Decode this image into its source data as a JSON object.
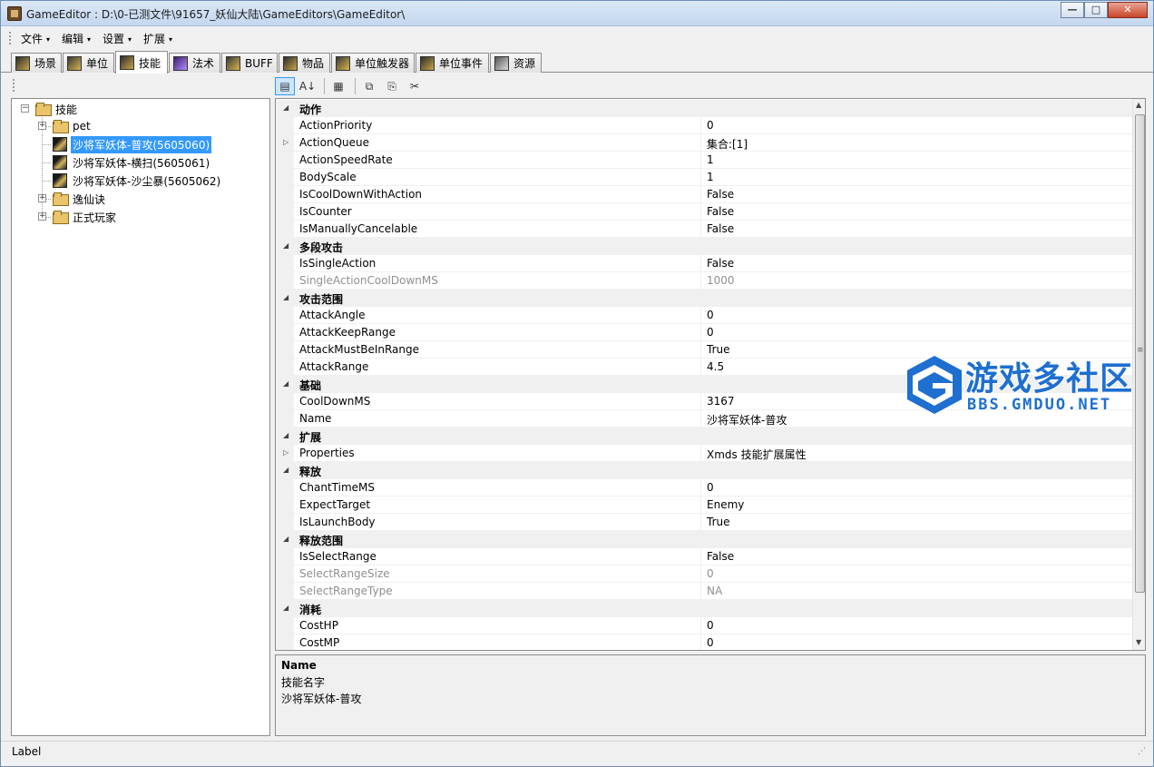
{
  "window": {
    "title": "GameEditor : D:\\0-已测文件\\91657_妖仙大陆\\GameEditors\\GameEditor\\",
    "controls": {
      "minimize": "—",
      "maximize": "□",
      "close": "✕"
    }
  },
  "menu": [
    {
      "label": "文件",
      "arrow": "▾"
    },
    {
      "label": "编辑",
      "arrow": "▾"
    },
    {
      "label": "设置",
      "arrow": "▾"
    },
    {
      "label": "扩展",
      "arrow": "▾"
    }
  ],
  "tabs": [
    {
      "label": "场景",
      "active": false
    },
    {
      "label": "单位",
      "active": false
    },
    {
      "label": "技能",
      "active": true
    },
    {
      "label": "法术",
      "active": false
    },
    {
      "label": "BUFF",
      "active": false
    },
    {
      "label": "物品",
      "active": false
    },
    {
      "label": "单位触发器",
      "active": false
    },
    {
      "label": "单位事件",
      "active": false
    },
    {
      "label": "资源",
      "active": false
    }
  ],
  "tree": {
    "root": "技能",
    "nodes": [
      {
        "label": "pet",
        "icon": "folder-icon",
        "expander": "+"
      },
      {
        "label": "沙将军妖体-普攻(5605060)",
        "icon": "skill-icon",
        "selected": true
      },
      {
        "label": "沙将军妖体-横扫(5605061)",
        "icon": "skill-icon"
      },
      {
        "label": "沙将军妖体-沙尘暴(5605062)",
        "icon": "skill-icon"
      },
      {
        "label": "逸仙诀",
        "icon": "folder-icon",
        "expander": "+"
      },
      {
        "label": "正式玩家",
        "icon": "folder-icon",
        "expander": "+"
      }
    ],
    "root_expander": "−"
  },
  "toolbar": {
    "categorized": "▤",
    "alphabetical": "A↓",
    "pages": "▦",
    "copy": "⧉",
    "paste": "⎘",
    "cut": "✂"
  },
  "grid": {
    "rows": [
      {
        "type": "cat",
        "name": "动作"
      },
      {
        "type": "prop",
        "name": "ActionPriority",
        "value": "0"
      },
      {
        "type": "prop",
        "name": "ActionQueue",
        "value": "集合:[1]",
        "expandable": true
      },
      {
        "type": "prop",
        "name": "ActionSpeedRate",
        "value": "1"
      },
      {
        "type": "prop",
        "name": "BodyScale",
        "value": "1"
      },
      {
        "type": "prop",
        "name": "IsCoolDownWithAction",
        "value": "False"
      },
      {
        "type": "prop",
        "name": "IsCounter",
        "value": "False"
      },
      {
        "type": "prop",
        "name": "IsManuallyCancelable",
        "value": "False"
      },
      {
        "type": "cat",
        "name": "多段攻击"
      },
      {
        "type": "prop",
        "name": "IsSingleAction",
        "value": "False"
      },
      {
        "type": "prop",
        "name": "SingleActionCoolDownMS",
        "value": "1000",
        "disabled": true
      },
      {
        "type": "cat",
        "name": "攻击范围"
      },
      {
        "type": "prop",
        "name": "AttackAngle",
        "value": "0"
      },
      {
        "type": "prop",
        "name": "AttackKeepRange",
        "value": "0"
      },
      {
        "type": "prop",
        "name": "AttackMustBeInRange",
        "value": "True"
      },
      {
        "type": "prop",
        "name": "AttackRange",
        "value": "4.5"
      },
      {
        "type": "cat",
        "name": "基础"
      },
      {
        "type": "prop",
        "name": "CoolDownMS",
        "value": "3167"
      },
      {
        "type": "prop",
        "name": "Name",
        "value": "沙将军妖体-普攻"
      },
      {
        "type": "cat",
        "name": "扩展"
      },
      {
        "type": "prop",
        "name": "Properties",
        "value": "Xmds 技能扩展属性",
        "expandable": true
      },
      {
        "type": "cat",
        "name": "释放"
      },
      {
        "type": "prop",
        "name": "ChantTimeMS",
        "value": "0"
      },
      {
        "type": "prop",
        "name": "ExpectTarget",
        "value": "Enemy"
      },
      {
        "type": "prop",
        "name": "IsLaunchBody",
        "value": "True"
      },
      {
        "type": "cat",
        "name": "释放范围"
      },
      {
        "type": "prop",
        "name": "IsSelectRange",
        "value": "False"
      },
      {
        "type": "prop",
        "name": "SelectRangeSize",
        "value": "0",
        "disabled": true
      },
      {
        "type": "prop",
        "name": "SelectRangeType",
        "value": "NA",
        "disabled": true
      },
      {
        "type": "cat",
        "name": "消耗"
      },
      {
        "type": "prop",
        "name": "CostHP",
        "value": "0"
      },
      {
        "type": "prop",
        "name": "CostMP",
        "value": "0"
      }
    ],
    "cat_marker": "◢",
    "expand_marker": "▷",
    "scroll_up": "▲",
    "scroll_down": "▼",
    "scroll_grip": "≡"
  },
  "help": {
    "title": "Name",
    "line1": "技能名字",
    "line2": "沙将军妖体-普攻"
  },
  "status": {
    "label": "Label",
    "grip": "⋰"
  },
  "watermark": {
    "cn": "游戏多社区",
    "en": "BBS.GMDUO.NET"
  },
  "colors": {
    "selection": "#3399ff",
    "watermark": "#1e6fd0"
  }
}
